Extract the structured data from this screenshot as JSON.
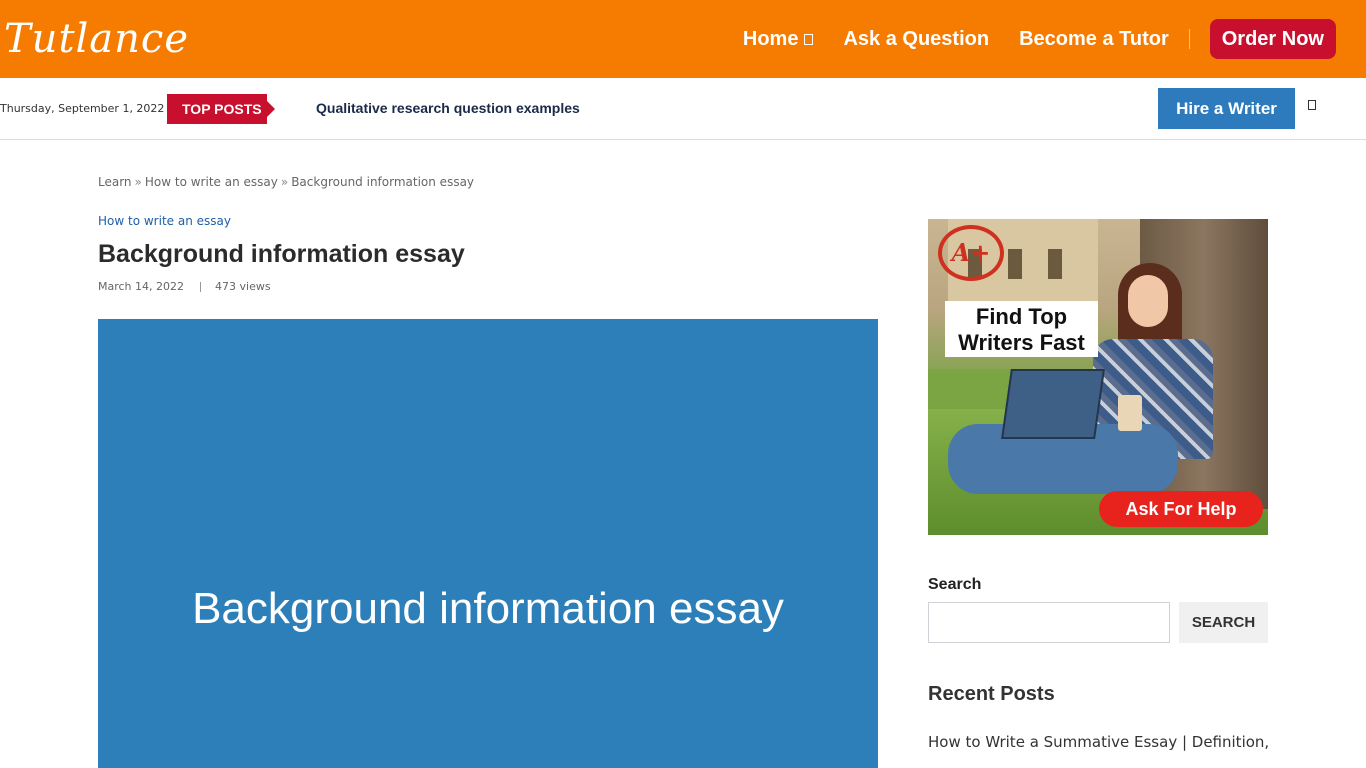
{
  "header": {
    "logo": "Tutlance",
    "nav": [
      {
        "label": "Home"
      },
      {
        "label": "Ask a Question"
      },
      {
        "label": "Become a Tutor"
      }
    ],
    "order_button": "Order Now",
    "bg_color": "#f57c00",
    "accent_red": "#c8102e"
  },
  "subbar": {
    "date": "Thursday, September 1, 2022",
    "top_posts_label": "TOP POSTS",
    "ticker": "Qualitative research question examples",
    "hire_button": "Hire a Writer",
    "hire_color": "#2d7bbd"
  },
  "breadcrumb": {
    "items": [
      "Learn",
      "How to write an essay",
      "Background information essay"
    ],
    "separator": "»"
  },
  "article": {
    "category": "How to write an essay",
    "title": "Background information essay",
    "date": "March 14, 2022",
    "views": "473 views",
    "hero_text": "Background information essay",
    "hero_color": "#2c7fb8"
  },
  "sidebar": {
    "ad": {
      "badge": "A+",
      "headline_line1": "Find Top",
      "headline_line2": "Writers Fast",
      "cta": "Ask For Help"
    },
    "search": {
      "label": "Search",
      "value": "",
      "button": "SEARCH"
    },
    "recent_posts": {
      "title": "Recent Posts",
      "items": [
        "How to Write a Summative Essay | Definition,"
      ]
    }
  }
}
